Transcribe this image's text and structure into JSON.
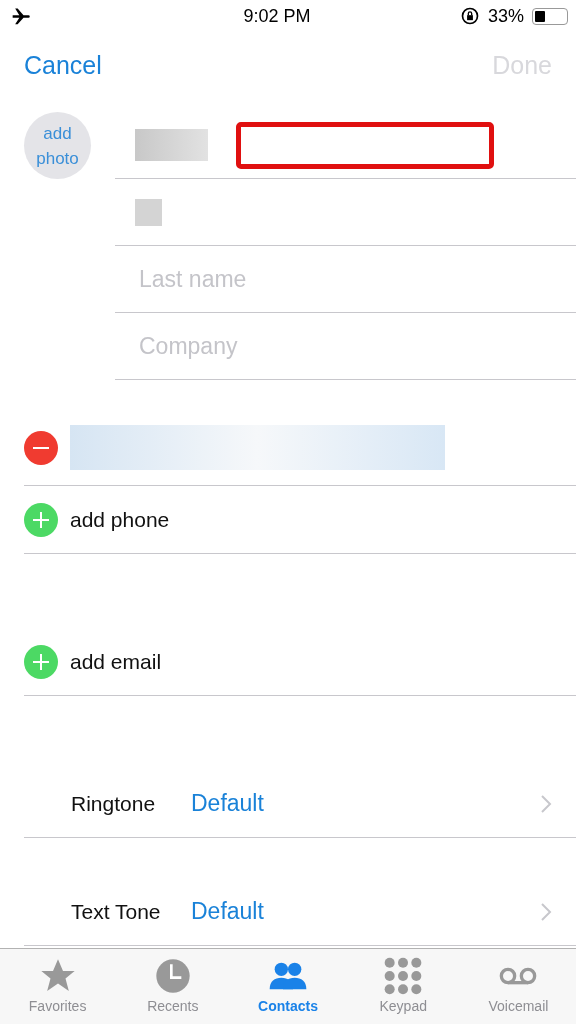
{
  "status_bar": {
    "time": "9:02 PM",
    "battery_text": "33%",
    "battery": {
      "level": 0.33
    }
  },
  "nav": {
    "cancel": "Cancel",
    "done": "Done",
    "done_disabled": true
  },
  "photo": {
    "label": "add photo"
  },
  "name_fields": [
    {
      "kind": "redacted",
      "highlighted": true
    },
    {
      "kind": "redacted",
      "highlighted": false
    },
    {
      "kind": "empty",
      "placeholder": "Last name"
    },
    {
      "kind": "empty",
      "placeholder": "Company"
    }
  ],
  "phones": [
    {
      "kind": "redacted"
    }
  ],
  "add_phone": "add phone",
  "add_email": "add email",
  "tones": [
    {
      "label": "Ringtone",
      "value": "Default"
    },
    {
      "label": "Text Tone",
      "value": "Default"
    }
  ],
  "tabs": [
    {
      "label": "Favorites",
      "kind": "star",
      "selected": false
    },
    {
      "label": "Recents",
      "kind": "clock",
      "selected": false
    },
    {
      "label": "Contacts",
      "kind": "people",
      "selected": true
    },
    {
      "label": "Keypad",
      "kind": "keypad",
      "selected": false
    },
    {
      "label": "Voicemail",
      "kind": "voicemail",
      "selected": false
    }
  ]
}
